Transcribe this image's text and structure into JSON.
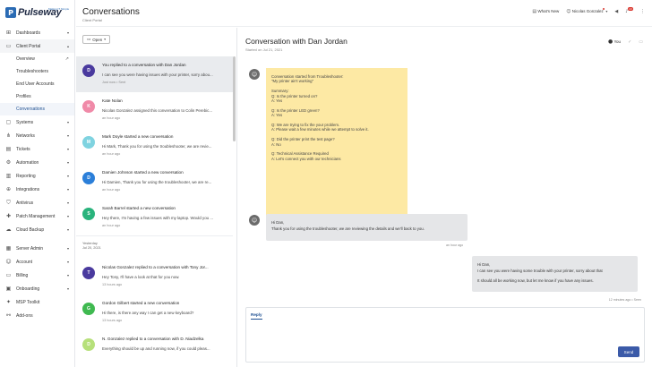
{
  "app": {
    "brand": "Pulseway",
    "tagline": "Making IT Simple"
  },
  "sidebar": {
    "items": [
      {
        "label": "Dashboards",
        "icon": "grid-icon",
        "chevron": "▾"
      },
      {
        "label": "Client Portal",
        "icon": "portal-icon",
        "chevron": "▴"
      },
      {
        "label": "Systems",
        "icon": "monitor-icon",
        "chevron": "▾"
      },
      {
        "label": "Networks",
        "icon": "network-icon",
        "chevron": "▾"
      },
      {
        "label": "Tickets",
        "icon": "ticket-icon",
        "chevron": "▾"
      },
      {
        "label": "Automation",
        "icon": "automation-icon",
        "chevron": "▾"
      },
      {
        "label": "Reporting",
        "icon": "chart-icon",
        "chevron": "▾"
      },
      {
        "label": "Integrations",
        "icon": "plug-icon",
        "chevron": "▾"
      },
      {
        "label": "Antivirus",
        "icon": "shield-icon",
        "chevron": "▾"
      },
      {
        "label": "Patch Management",
        "icon": "patch-icon",
        "chevron": "▾"
      },
      {
        "label": "Cloud Backup",
        "icon": "cloud-icon",
        "chevron": "▾"
      },
      {
        "label": "Server Admin",
        "icon": "server-icon",
        "chevron": "▾"
      },
      {
        "label": "Account",
        "icon": "user-icon",
        "chevron": "▾"
      },
      {
        "label": "Billing",
        "icon": "card-icon",
        "chevron": "▾"
      },
      {
        "label": "Onboarding",
        "icon": "onboarding-icon",
        "chevron": "▾"
      },
      {
        "label": "MSP Toolkit",
        "icon": "toolkit-icon"
      },
      {
        "label": "Add-ons",
        "icon": "addons-icon"
      }
    ],
    "client_portal_sub": [
      "Overview",
      "Troubleshooters",
      "End User Accounts",
      "Profiles",
      "Conversations"
    ]
  },
  "header": {
    "title": "Conversations",
    "subtitle": "Client Portal",
    "whats_new": "What's New",
    "user": "Nicolas Gonzalez",
    "notif_count": "10"
  },
  "list": {
    "filter_label": "Open",
    "conversations_today": [
      {
        "title": "You replied to a conversation with Dan Jordan",
        "body": "I can see you were having issues with your printer, sorry abou...",
        "time": "Just now • Sent",
        "initial": "D",
        "color": "#4a3a9e",
        "selected": true
      },
      {
        "title": "Kate Nolan",
        "body": "Nicolas Gonzalez assigned this conversation to Colin Perebic...",
        "time": "an hour ago",
        "initial": "K",
        "color": "#f08aa8"
      },
      {
        "title": "Mark Doyle started a new conversation",
        "body": "Hi Mark, Thank you for using the troubleshooter, we are revie...",
        "time": "an hour ago",
        "initial": "M",
        "color": "#7fd3e0"
      },
      {
        "title": "Damien Johnson started a new conversation",
        "body": "Hi Damien, Thank you for using the troubleshooter, we are re...",
        "time": "an hour ago",
        "initial": "D",
        "color": "#2b7fd9"
      },
      {
        "title": "Sarah Barrel started a new conversation",
        "body": "Hey there, I'm having a few issues with my laptop. Would you ...",
        "time": "an hour ago",
        "initial": "S",
        "color": "#29b37c"
      }
    ],
    "day_label": "Yesterday",
    "day_date": "Jul 20, 2021",
    "conversations_yesterday": [
      {
        "title": "Nicolas Gonzalez replied to a conversation with Tony Jor...",
        "body": "Hey Tony, I'll have a look at that for you now.",
        "time": "13 hours ago",
        "initial": "T",
        "color": "#4a3a9e"
      },
      {
        "title": "Gordon Gilbert started a new conversation",
        "body": "Hi there, is there any way I can get a new keyboard?",
        "time": "13 hours ago",
        "initial": "G",
        "color": "#3fb950"
      },
      {
        "title": "N. Gonzalez replied to a conversation with D. Niadzelka",
        "body": "Everything should be up and running now, if you could pleas...",
        "time": "",
        "initial": "D",
        "color": "#b6e07a"
      }
    ]
  },
  "detail": {
    "title": "Conversation with Dan Jordan",
    "started": "Started on Jul 21, 2021",
    "assignee": "You",
    "note_lines": [
      "Conversation started from Troubleshooter:",
      "\"My printer ain't working\"",
      "",
      "Summary:",
      "Q: Is the printer turned on?",
      "A: Yes",
      "",
      "Q: Is the printer LED green?",
      "A: Yes",
      "",
      "Q: We are trying to fix the your problem.",
      "A: Please wait a few minutes while we attempt to solve it.",
      "",
      "Q: Did the printer print the test page?",
      "A: No",
      "",
      "Q: Technical Assistance Required",
      "A: Let's connect you with our technicians"
    ],
    "incoming": {
      "line1": "Hi Dan,",
      "line2": "Thank you for using the troubleshooter, we are reviewing the details and we'll back to you.",
      "time": "an hour ago"
    },
    "outgoing": {
      "line1": "Hi Dan,",
      "line2": "I can see you were having some trouble with your printer, sorry about that",
      "line3": "It should all be working now, but let me know if you have any issues.",
      "time": "12 minutes ago • Seen"
    },
    "reply_tab": "Reply",
    "reply_placeholder": "",
    "send_label": "Send"
  }
}
